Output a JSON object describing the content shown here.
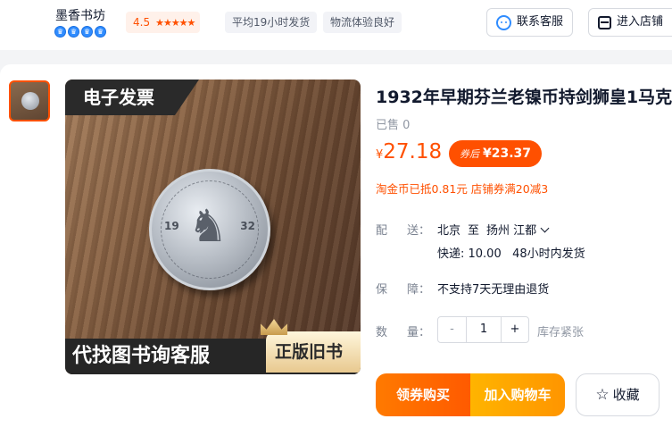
{
  "store": {
    "name": "墨香书坊",
    "crown_count": 4,
    "rating_score": "4.5",
    "rating_stars": "★★★★★",
    "pill_shipping": "平均19小时发货",
    "pill_logistics": "物流体验良好",
    "contact_label": "联系客服",
    "enter_shop_label": "进入店铺"
  },
  "gallery": {
    "top_banner": "电子发票",
    "bottom_banner": "代找图书询客服",
    "badge": "正版旧书",
    "coin_year_left": "19",
    "coin_year_right": "32"
  },
  "product": {
    "title": "1932年早期芬兰老镍币持剑狮皇1马克",
    "sold": "已售 0",
    "price_currency": "¥",
    "price": "27.18",
    "coupon_tag": "券后",
    "coupon_price": "¥23.37",
    "promo": "淘金币已抵0.81元 店铺券满20减3"
  },
  "shipping": {
    "label_a": "配",
    "label_b": "送：",
    "from": "北京",
    "to_word": "至",
    "dest": "扬州 江都",
    "fee": "快递: 10.00",
    "dispatch": "48小时内发货"
  },
  "guarantee": {
    "label_a": "保",
    "label_b": "障：",
    "value": "不支持7天无理由退货"
  },
  "quantity": {
    "label_a": "数",
    "label_b": "量：",
    "minus": "-",
    "value": "1",
    "plus": "+",
    "stock": "库存紧张"
  },
  "actions": {
    "buy": "领券购买",
    "cart": "加入购物车",
    "favorite": "收藏"
  },
  "colors": {
    "accent": "#ff5000",
    "cart": "#ffa200",
    "link_blue": "#2f8cff"
  }
}
